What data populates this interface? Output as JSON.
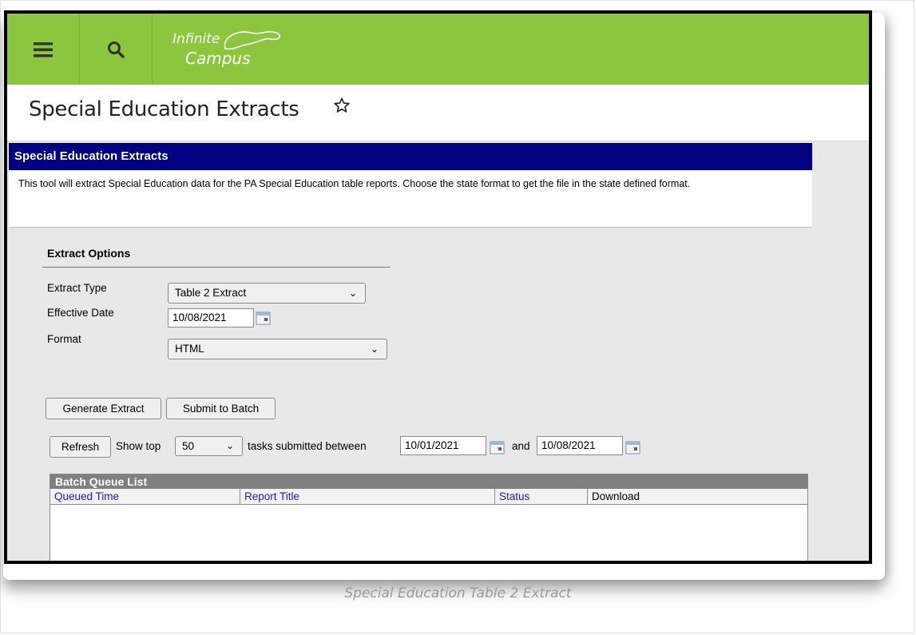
{
  "app": {
    "logo_line1": "Infinite",
    "logo_line2": "Campus"
  },
  "page": {
    "title": "Special Education Extracts"
  },
  "section": {
    "header": "Special Education Extracts",
    "description": "This tool will extract Special Education data for the PA Special Education table reports. Choose the state format to get the file in the state defined format."
  },
  "extract_options": {
    "heading": "Extract Options",
    "extract_type_label": "Extract Type",
    "extract_type_value": "Table 2 Extract",
    "effective_date_label": "Effective Date",
    "effective_date_value": "10/08/2021",
    "format_label": "Format",
    "format_value": "HTML"
  },
  "actions": {
    "generate_label": "Generate Extract",
    "batch_label": "Submit to Batch"
  },
  "batch_filter": {
    "refresh_label": "Refresh",
    "show_top_label": "Show top",
    "show_top_value": "50",
    "between_label": "tasks submitted between",
    "start_date": "10/01/2021",
    "and_label": "and",
    "end_date": "10/08/2021"
  },
  "queue": {
    "title": "Batch Queue List",
    "columns": [
      "Queued Time",
      "Report Title",
      "Status",
      "Download"
    ]
  },
  "caption": "Special Education Table 2 Extract",
  "colors": {
    "topbar": "#8cc63f",
    "section_header": "#000080",
    "link": "#1a1ad6"
  }
}
